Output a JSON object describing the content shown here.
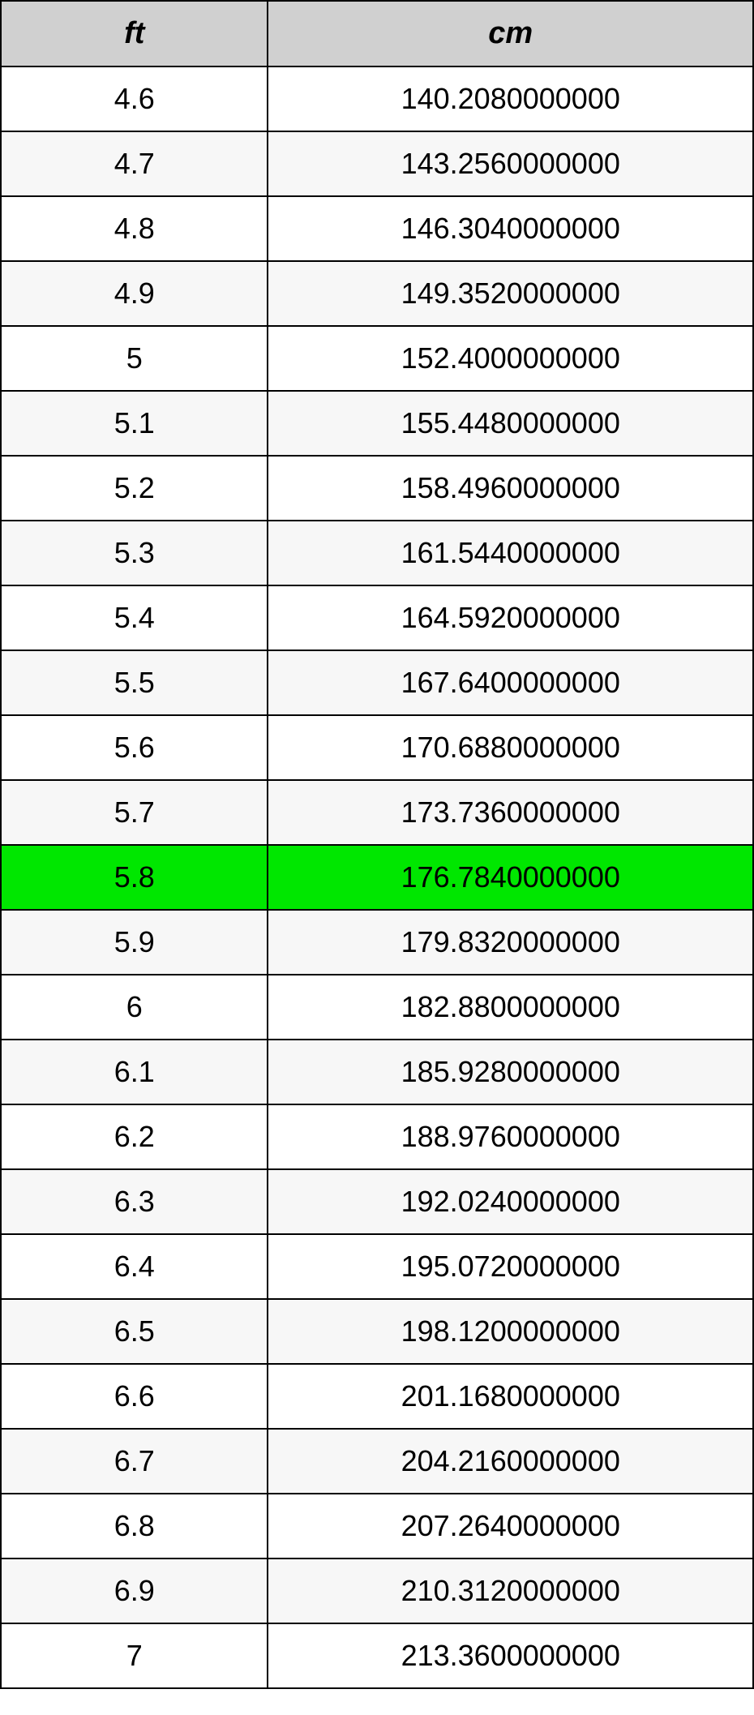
{
  "table": {
    "headers": {
      "col1": "ft",
      "col2": "cm"
    },
    "highlightIndex": 12,
    "rows": [
      {
        "ft": "4.6",
        "cm": "140.2080000000"
      },
      {
        "ft": "4.7",
        "cm": "143.2560000000"
      },
      {
        "ft": "4.8",
        "cm": "146.3040000000"
      },
      {
        "ft": "4.9",
        "cm": "149.3520000000"
      },
      {
        "ft": "5",
        "cm": "152.4000000000"
      },
      {
        "ft": "5.1",
        "cm": "155.4480000000"
      },
      {
        "ft": "5.2",
        "cm": "158.4960000000"
      },
      {
        "ft": "5.3",
        "cm": "161.5440000000"
      },
      {
        "ft": "5.4",
        "cm": "164.5920000000"
      },
      {
        "ft": "5.5",
        "cm": "167.6400000000"
      },
      {
        "ft": "5.6",
        "cm": "170.6880000000"
      },
      {
        "ft": "5.7",
        "cm": "173.7360000000"
      },
      {
        "ft": "5.8",
        "cm": "176.7840000000"
      },
      {
        "ft": "5.9",
        "cm": "179.8320000000"
      },
      {
        "ft": "6",
        "cm": "182.8800000000"
      },
      {
        "ft": "6.1",
        "cm": "185.9280000000"
      },
      {
        "ft": "6.2",
        "cm": "188.9760000000"
      },
      {
        "ft": "6.3",
        "cm": "192.0240000000"
      },
      {
        "ft": "6.4",
        "cm": "195.0720000000"
      },
      {
        "ft": "6.5",
        "cm": "198.1200000000"
      },
      {
        "ft": "6.6",
        "cm": "201.1680000000"
      },
      {
        "ft": "6.7",
        "cm": "204.2160000000"
      },
      {
        "ft": "6.8",
        "cm": "207.2640000000"
      },
      {
        "ft": "6.9",
        "cm": "210.3120000000"
      },
      {
        "ft": "7",
        "cm": "213.3600000000"
      }
    ]
  }
}
